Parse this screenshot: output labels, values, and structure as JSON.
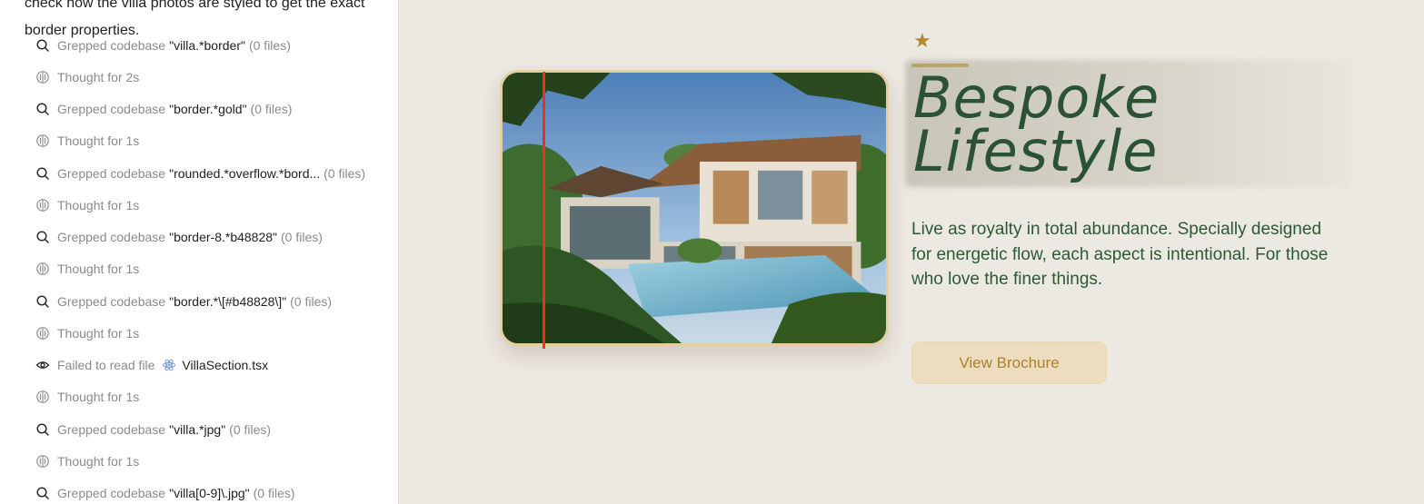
{
  "log": {
    "intro_line1": "check how the villa photos are styled to get the exact",
    "intro_line2": "border properties.",
    "rows": [
      {
        "icon": "search-icon",
        "verb": "Grepped codebase",
        "query": "\"villa.*border\"",
        "count": "(0 files)"
      },
      {
        "icon": "brain-icon",
        "verb": "Thought for 2s"
      },
      {
        "icon": "search-icon",
        "verb": "Grepped codebase",
        "query": "\"border.*gold\"",
        "count": "(0 files)"
      },
      {
        "icon": "brain-icon",
        "verb": "Thought for 1s"
      },
      {
        "icon": "search-icon",
        "verb": "Grepped codebase",
        "query": "\"rounded.*overflow.*bord...",
        "count": "(0 files)"
      },
      {
        "icon": "brain-icon",
        "verb": "Thought for 1s"
      },
      {
        "icon": "search-icon",
        "verb": "Grepped codebase",
        "query": "\"border-8.*b48828\"",
        "count": "(0 files)"
      },
      {
        "icon": "brain-icon",
        "verb": "Thought for 1s"
      },
      {
        "icon": "search-icon",
        "verb": "Grepped codebase",
        "query": "\"border.*\\[#b48828\\]\"",
        "count": "(0 files)"
      },
      {
        "icon": "brain-icon",
        "verb": "Thought for 1s"
      },
      {
        "icon": "eye-icon",
        "verb": "Failed to read file",
        "file": "VillaSection.tsx"
      },
      {
        "icon": "brain-icon",
        "verb": "Thought for 1s"
      },
      {
        "icon": "search-icon",
        "verb": "Grepped codebase",
        "query": "\"villa.*jpg\"",
        "count": "(0 files)"
      },
      {
        "icon": "brain-icon",
        "verb": "Thought for 1s"
      },
      {
        "icon": "search-icon",
        "verb": "Grepped codebase",
        "query": "\"villa[0-9]\\.jpg\"",
        "count": "(0 files)"
      }
    ]
  },
  "preview": {
    "star": "★",
    "heading_line1": "Bespoke",
    "heading_line2": "Lifestyle",
    "description": "Live as royalty in total abundance. Specially designed for energetic flow, each aspect is intentional. For those who love the finer things.",
    "button_label": "View Brochure",
    "colors": {
      "heading": "#2b5234",
      "gold": "#c99d3b",
      "button_bg": "#eddcbd",
      "guide_line": "#e43321",
      "frame_border": "#e3cf9f"
    }
  }
}
